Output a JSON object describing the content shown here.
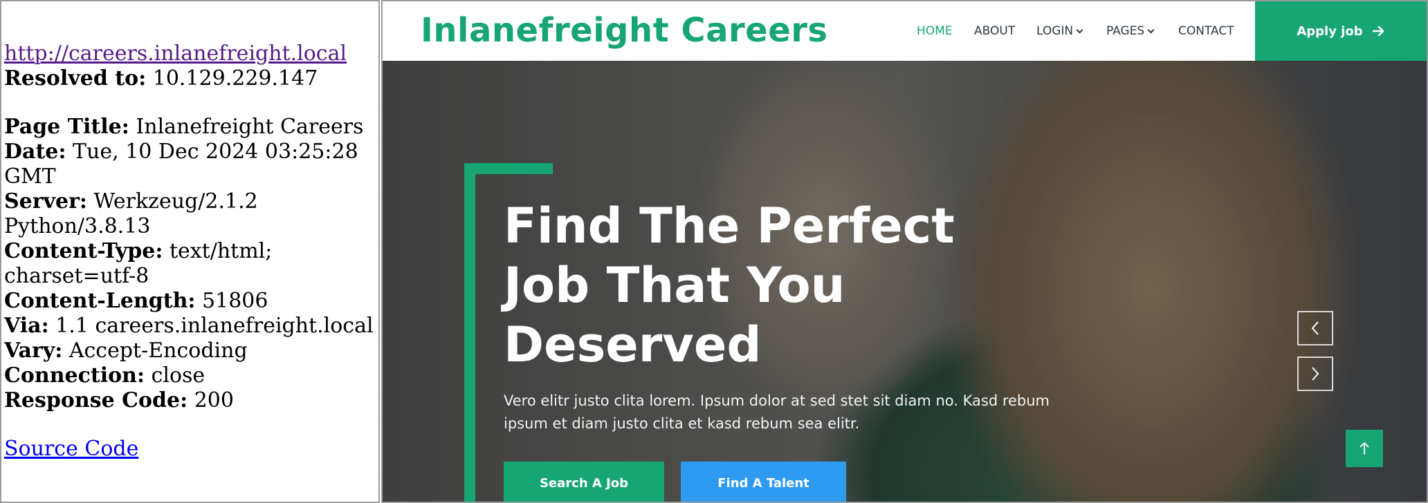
{
  "info": {
    "url": "http://careers.inlanefreight.local",
    "resolved_label": "Resolved to:",
    "resolved_value": "10.129.229.147",
    "title_label": "Page Title:",
    "title_value": "Inlanefreight Careers",
    "date_label": "Date:",
    "date_value": "Tue, 10 Dec 2024 03:25:28 GMT",
    "server_label": "Server:",
    "server_value": "Werkzeug/2.1.2 Python/3.8.13",
    "ctype_label": "Content-Type:",
    "ctype_value": "text/html; charset=utf-8",
    "clen_label": "Content-Length:",
    "clen_value": "51806",
    "via_label": "Via:",
    "via_value": "1.1 careers.inlanefreight.local",
    "vary_label": "Vary:",
    "vary_value": "Accept-Encoding",
    "conn_label": "Connection:",
    "conn_value": "close",
    "code_label": "Response Code:",
    "code_value": "200",
    "source_link": "Source Code"
  },
  "site": {
    "brand": "Inlanefreight Careers",
    "nav": {
      "home": "HOME",
      "about": "ABOUT",
      "login": "LOGIN",
      "pages": "PAGES",
      "contact": "CONTACT"
    },
    "apply_label": "Apply job",
    "hero": {
      "title": "Find The Perfect Job That You Deserved",
      "text": "Vero elitr justo clita lorem. Ipsum dolor at sed stet sit diam no. Kasd rebum ipsum et diam justo clita et kasd rebum sea elitr.",
      "btn_search": "Search A Job",
      "btn_talent": "Find A Talent"
    }
  },
  "icons": {
    "apply": "arrow-right-icon",
    "prev": "chevron-left-icon",
    "next": "chevron-right-icon",
    "back_to_top": "arrow-up-icon",
    "dropdown": "chevron-down-icon"
  },
  "colors": {
    "accent_green": "#17a673",
    "accent_blue": "#2e9bf0",
    "link_visited": "#551a8b",
    "link": "#0000ee"
  }
}
